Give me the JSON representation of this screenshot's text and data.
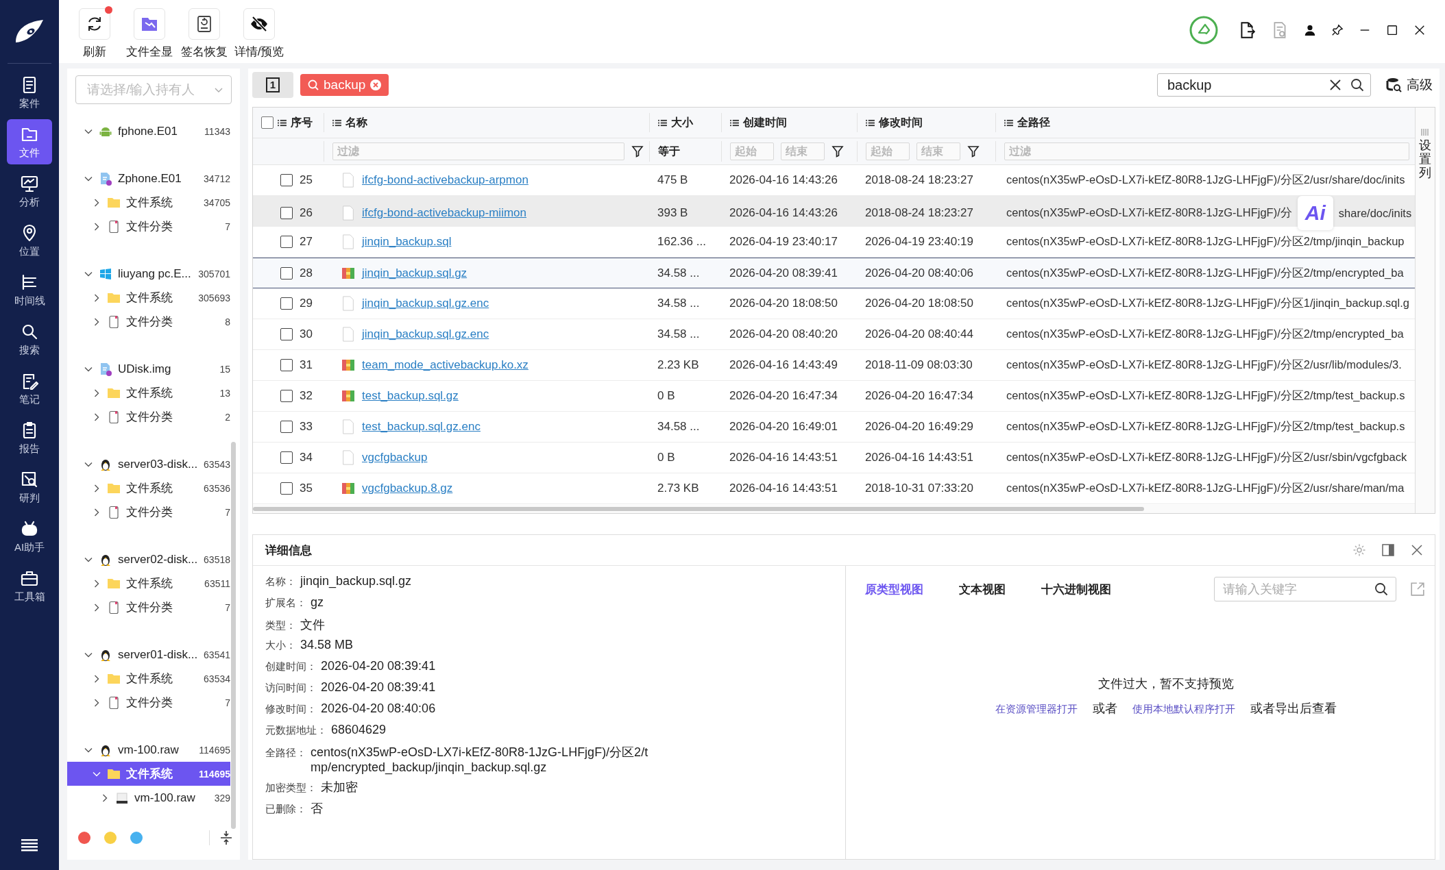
{
  "nav": {
    "items": [
      {
        "label": "案件",
        "selected": false
      },
      {
        "label": "文件",
        "selected": true
      },
      {
        "label": "分析",
        "selected": false
      },
      {
        "label": "位置",
        "selected": false
      },
      {
        "label": "时间线",
        "selected": false
      },
      {
        "label": "搜索",
        "selected": false
      },
      {
        "label": "笔记",
        "selected": false
      },
      {
        "label": "报告",
        "selected": false
      },
      {
        "label": "研判",
        "selected": false
      },
      {
        "label": "AI助手",
        "selected": false
      },
      {
        "label": "工具箱",
        "selected": false
      }
    ]
  },
  "toolbar": {
    "tools": [
      {
        "label": "刷新",
        "badge": true
      },
      {
        "label": "文件全显",
        "badge": false
      },
      {
        "label": "签名恢复",
        "badge": false
      },
      {
        "label": "详情/预览",
        "badge": false
      }
    ]
  },
  "owner_select": {
    "placeholder": "请选择/输入持有人"
  },
  "tree": [
    {
      "name": "fphone.E01",
      "kind": "android",
      "count": "11343",
      "expanded": true,
      "selected": false
    },
    {
      "name": "Zphone.E01",
      "kind": "image",
      "count": "34712",
      "expanded": true,
      "selected": false,
      "children": [
        {
          "name": "文件系统",
          "kind": "folder",
          "count": "34705",
          "expanded": false,
          "selected": false
        },
        {
          "name": "文件分类",
          "kind": "category",
          "count": "7",
          "expanded": false,
          "selected": false
        }
      ]
    },
    {
      "name": "liuyang pc.E...",
      "kind": "windows",
      "count": "305701",
      "expanded": true,
      "selected": false,
      "children": [
        {
          "name": "文件系统",
          "kind": "folder",
          "count": "305693",
          "expanded": false,
          "selected": false
        },
        {
          "name": "文件分类",
          "kind": "category",
          "count": "8",
          "expanded": false,
          "selected": false
        }
      ]
    },
    {
      "name": "UDisk.img",
      "kind": "image",
      "count": "15",
      "expanded": true,
      "selected": false,
      "children": [
        {
          "name": "文件系统",
          "kind": "folder",
          "count": "13",
          "expanded": false,
          "selected": false
        },
        {
          "name": "文件分类",
          "kind": "category",
          "count": "2",
          "expanded": false,
          "selected": false
        }
      ]
    },
    {
      "name": "server03-disk...",
      "kind": "linux",
      "count": "63543",
      "expanded": true,
      "selected": false,
      "children": [
        {
          "name": "文件系统",
          "kind": "folder",
          "count": "63536",
          "expanded": false,
          "selected": false
        },
        {
          "name": "文件分类",
          "kind": "category",
          "count": "7",
          "expanded": false,
          "selected": false
        }
      ]
    },
    {
      "name": "server02-disk...",
      "kind": "linux",
      "count": "63518",
      "expanded": true,
      "selected": false,
      "children": [
        {
          "name": "文件系统",
          "kind": "folder",
          "count": "63511",
          "expanded": false,
          "selected": false
        },
        {
          "name": "文件分类",
          "kind": "category",
          "count": "7",
          "expanded": false,
          "selected": false
        }
      ]
    },
    {
      "name": "server01-disk...",
      "kind": "linux",
      "count": "63541",
      "expanded": true,
      "selected": false,
      "children": [
        {
          "name": "文件系统",
          "kind": "folder",
          "count": "63534",
          "expanded": false,
          "selected": false
        },
        {
          "name": "文件分类",
          "kind": "category",
          "count": "7",
          "expanded": false,
          "selected": false
        }
      ]
    },
    {
      "name": "vm-100.raw",
      "kind": "linux",
      "count": "114695",
      "expanded": true,
      "selected": false,
      "children": [
        {
          "name": "文件系统",
          "kind": "folder",
          "count": "114695",
          "expanded": true,
          "selected": true,
          "children": [
            {
              "name": "vm-100.raw",
              "kind": "disk",
              "count": "329",
              "expanded": false,
              "selected": false
            }
          ]
        }
      ]
    }
  ],
  "theme_dots": [
    {
      "color": "#f0564f"
    },
    {
      "color": "#f8d046"
    },
    {
      "color": "#47b1ef"
    }
  ],
  "page_tab": "1",
  "search_chip": "backup",
  "search": {
    "value": "backup"
  },
  "advanced_button": "高级",
  "table": {
    "all_checked": false,
    "columns": [
      {
        "label": "序号"
      },
      {
        "label": "名称"
      },
      {
        "label": "大小"
      },
      {
        "label": "创建时间"
      },
      {
        "label": "修改时间"
      },
      {
        "label": "全路径"
      }
    ],
    "filters": {
      "name": {
        "placeholder": "过滤"
      },
      "size": "等于",
      "created_from": {
        "placeholder": "起始"
      },
      "created_to": {
        "placeholder": "结束"
      },
      "modified_from": {
        "placeholder": "起始"
      },
      "modified_to": {
        "placeholder": "结束"
      },
      "path": {
        "placeholder": "过滤"
      }
    },
    "rows": [
      {
        "index": "25",
        "name": "ifcfg-bond-activebackup-arpmon",
        "kind": "file",
        "size": "475 B",
        "created": "2026-04-16 14:43:26",
        "modified": "2018-08-24 18:23:27",
        "path": [
          "centos(nX35wP-eOsD-LX7i-kEfZ-80R8-1JzG-LHFjgF)/分区2/usr/share/doc/inits"
        ],
        "checked": false,
        "selected": false,
        "hovered": false
      },
      {
        "index": "26",
        "name": "ifcfg-bond-activebackup-miimon",
        "kind": "file",
        "size": "393 B",
        "created": "2026-04-16 14:43:26",
        "modified": "2018-08-24 18:23:27",
        "path": [
          "centos(nX35wP-eOsD-LX7i-kEfZ-80R8-1JzG-LHFjgF)/分",
          "share/doc/inits"
        ],
        "checked": false,
        "selected": false,
        "hovered": true
      },
      {
        "index": "27",
        "name": "jinqin_backup.sql",
        "kind": "file",
        "size": "162.36 ...",
        "created": "2026-04-19 23:40:17",
        "modified": "2026-04-19 23:40:19",
        "path": [
          "centos(nX35wP-eOsD-LX7i-kEfZ-80R8-1JzG-LHFjgF)/分区2/tmp/jinqin_backup"
        ],
        "checked": false,
        "selected": false,
        "hovered": false
      },
      {
        "index": "28",
        "name": "jinqin_backup.sql.gz",
        "kind": "archive",
        "size": "34.58 ...",
        "created": "2026-04-20 08:39:41",
        "modified": "2026-04-20 08:40:06",
        "path": [
          "centos(nX35wP-eOsD-LX7i-kEfZ-80R8-1JzG-LHFjgF)/分区2/tmp/encrypted_ba"
        ],
        "checked": false,
        "selected": true,
        "hovered": false
      },
      {
        "index": "29",
        "name": "jinqin_backup.sql.gz.enc",
        "kind": "file",
        "size": "34.58 ...",
        "created": "2026-04-20 18:08:50",
        "modified": "2026-04-20 18:08:50",
        "path": [
          "centos(nX35wP-eOsD-LX7i-kEfZ-80R8-1JzG-LHFjgF)/分区1/jinqin_backup.sql.g"
        ],
        "checked": false,
        "selected": false,
        "hovered": false
      },
      {
        "index": "30",
        "name": "jinqin_backup.sql.gz.enc",
        "kind": "file",
        "size": "34.58 ...",
        "created": "2026-04-20 08:40:20",
        "modified": "2026-04-20 08:40:44",
        "path": [
          "centos(nX35wP-eOsD-LX7i-kEfZ-80R8-1JzG-LHFjgF)/分区2/tmp/encrypted_ba"
        ],
        "checked": false,
        "selected": false,
        "hovered": false
      },
      {
        "index": "31",
        "name": "team_mode_activebackup.ko.xz",
        "kind": "archive",
        "size": "2.23 KB",
        "created": "2026-04-16 14:43:49",
        "modified": "2018-11-09 08:03:30",
        "path": [
          "centos(nX35wP-eOsD-LX7i-kEfZ-80R8-1JzG-LHFjgF)/分区2/usr/lib/modules/3."
        ],
        "checked": false,
        "selected": false,
        "hovered": false
      },
      {
        "index": "32",
        "name": "test_backup.sql.gz",
        "kind": "archive",
        "size": "0 B",
        "created": "2026-04-20 16:47:34",
        "modified": "2026-04-20 16:47:34",
        "path": [
          "centos(nX35wP-eOsD-LX7i-kEfZ-80R8-1JzG-LHFjgF)/分区2/tmp/test_backup.s"
        ],
        "checked": false,
        "selected": false,
        "hovered": false
      },
      {
        "index": "33",
        "name": "test_backup.sql.gz.enc",
        "kind": "file",
        "size": "34.58 ...",
        "created": "2026-04-20 16:49:01",
        "modified": "2026-04-20 16:49:29",
        "path": [
          "centos(nX35wP-eOsD-LX7i-kEfZ-80R8-1JzG-LHFjgF)/分区2/tmp/test_backup.s"
        ],
        "checked": false,
        "selected": false,
        "hovered": false
      },
      {
        "index": "34",
        "name": "vgcfgbackup",
        "kind": "file",
        "size": "0 B",
        "created": "2026-04-16 14:43:51",
        "modified": "2026-04-16 14:43:51",
        "path": [
          "centos(nX35wP-eOsD-LX7i-kEfZ-80R8-1JzG-LHFjgF)/分区2/usr/sbin/vgcfgback"
        ],
        "checked": false,
        "selected": false,
        "hovered": false
      },
      {
        "index": "35",
        "name": "vgcfgbackup.8.gz",
        "kind": "archive",
        "size": "2.73 KB",
        "created": "2026-04-16 14:43:51",
        "modified": "2018-10-31 07:33:20",
        "path": [
          "centos(nX35wP-eOsD-LX7i-kEfZ-80R8-1JzG-LHFjgF)/分区2/usr/share/man/ma"
        ],
        "checked": false,
        "selected": false,
        "hovered": false
      }
    ],
    "column_settings": "设置列"
  },
  "ai_badge": "Ai",
  "details": {
    "title": "详细信息",
    "fields": [
      {
        "label": "名称：",
        "value": "jinqin_backup.sql.gz"
      },
      {
        "label": "扩展名：",
        "value": "gz"
      },
      {
        "label": "类型：",
        "value": "文件"
      },
      {
        "label": "大小：",
        "value": "34.58 MB"
      },
      {
        "label": "创建时间：",
        "value": "2026-04-20 08:39:41"
      },
      {
        "label": "访问时间：",
        "value": "2026-04-20 08:39:41"
      },
      {
        "label": "修改时间：",
        "value": "2026-04-20 08:40:06"
      },
      {
        "label": "元数据地址：",
        "value": "68604629"
      },
      {
        "label": "全路径：",
        "value": "centos(nX35wP-eOsD-LX7i-kEfZ-80R8-1JzG-LHFjgF)/分区2/tmp/encrypted_backup/jinqin_backup.sql.gz"
      },
      {
        "label": "加密类型：",
        "value": "未加密"
      },
      {
        "label": "已删除：",
        "value": "否"
      }
    ],
    "preview": {
      "tabs": [
        {
          "label": "原类型视图",
          "selected": true
        },
        {
          "label": "文本视图",
          "selected": false
        },
        {
          "label": "十六进制视图",
          "selected": false
        }
      ],
      "search_placeholder": "请输入关键字",
      "message": "文件过大，暂不支持预览",
      "actions": [
        {
          "text": "在资源管理器打开",
          "kind": "link"
        },
        {
          "text": "或者",
          "kind": "text"
        },
        {
          "text": "使用本地默认程序打开",
          "kind": "link"
        },
        {
          "text": "或者导出后查看",
          "kind": "text"
        }
      ]
    }
  }
}
